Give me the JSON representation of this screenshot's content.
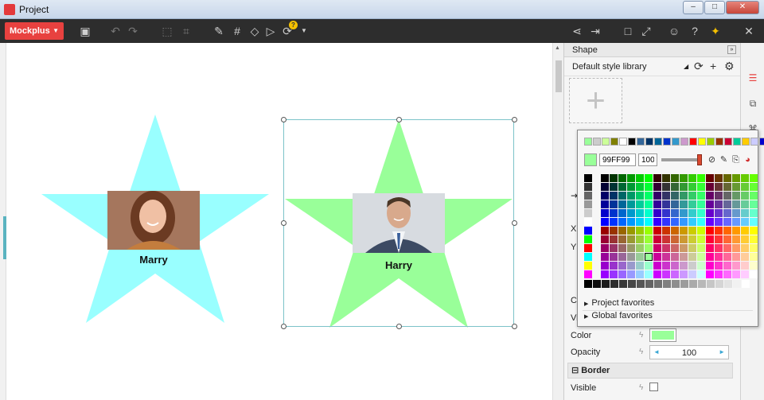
{
  "window": {
    "title": "Project",
    "controls": [
      "–",
      "□",
      "✕"
    ]
  },
  "toolbar": {
    "brand": "Mockplus",
    "icons": [
      "save-icon",
      "undo-icon",
      "redo-icon",
      "group-icon",
      "ungroup-icon",
      "brush-icon",
      "grid-icon",
      "paint-bucket-icon",
      "play-icon",
      "sync-icon",
      "share-icon",
      "export-icon",
      "frame-icon",
      "fullscreen-icon",
      "users-icon",
      "help-icon",
      "gift-icon",
      "close-icon"
    ],
    "sync_badge": "?"
  },
  "canvas": {
    "cards": [
      {
        "name": "Marry",
        "star_color": "#99FFFF",
        "selected": false
      },
      {
        "name": "Harry",
        "star_color": "#99FF99",
        "selected": true
      }
    ]
  },
  "panel": {
    "title": "Shape",
    "library": "Default style library",
    "properties": {
      "x_label": "X",
      "y_label": "Y",
      "ca_label": "Ca",
      "vi_label": "Vi",
      "color_label": "Color",
      "color_value": "#99FF99",
      "opacity_label": "Opacity",
      "opacity_value": "100",
      "border_section": "Border",
      "visible_label": "Visible"
    }
  },
  "color_picker": {
    "hex": "99FF99",
    "alpha": "100",
    "selected_color": "#99FF99",
    "recent": [
      "#99FF99",
      "#cccccc",
      "#ccff99",
      "#808000",
      "#ffffff",
      "#000000",
      "#336699",
      "#003366",
      "#006699",
      "#0033cc",
      "#3399cc",
      "#cc99cc",
      "#ff0000",
      "#ffff00",
      "#99cc00",
      "#993300",
      "#cc0033",
      "#00cc99",
      "#ffcc00",
      "#ccccff",
      "#0000cc"
    ],
    "favorites": [
      "Project favorites",
      "Global favorites"
    ]
  }
}
